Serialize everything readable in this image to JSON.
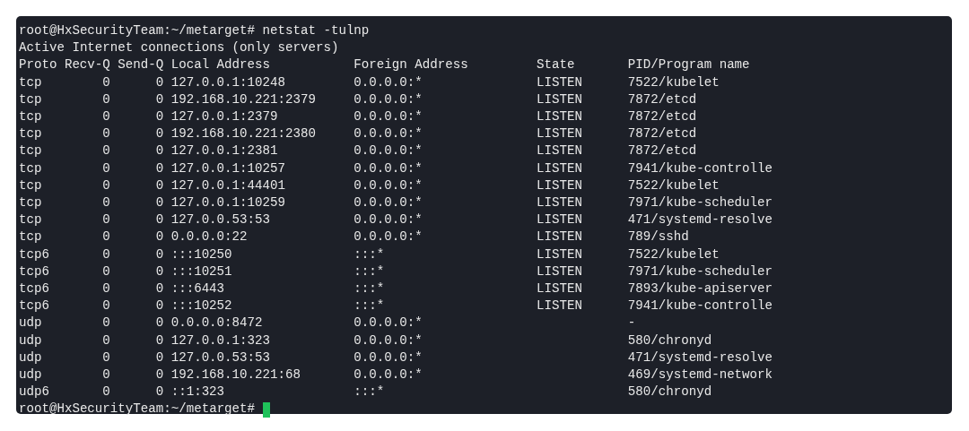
{
  "terminal": {
    "command_line": "root@HxSecurityTeam:~/metarget# netstat -tulnp",
    "output_title": "Active Internet connections (only servers)",
    "columns": [
      "Proto",
      "Recv-Q",
      "Send-Q",
      "Local Address",
      "Foreign Address",
      "State",
      "PID/Program name"
    ],
    "rows": [
      {
        "proto": "tcp",
        "recv_q": "0",
        "send_q": "0",
        "local_address": "127.0.0.1:10248",
        "foreign_address": "0.0.0.0:*",
        "state": "LISTEN",
        "program": "7522/kubelet"
      },
      {
        "proto": "tcp",
        "recv_q": "0",
        "send_q": "0",
        "local_address": "192.168.10.221:2379",
        "foreign_address": "0.0.0.0:*",
        "state": "LISTEN",
        "program": "7872/etcd"
      },
      {
        "proto": "tcp",
        "recv_q": "0",
        "send_q": "0",
        "local_address": "127.0.0.1:2379",
        "foreign_address": "0.0.0.0:*",
        "state": "LISTEN",
        "program": "7872/etcd"
      },
      {
        "proto": "tcp",
        "recv_q": "0",
        "send_q": "0",
        "local_address": "192.168.10.221:2380",
        "foreign_address": "0.0.0.0:*",
        "state": "LISTEN",
        "program": "7872/etcd"
      },
      {
        "proto": "tcp",
        "recv_q": "0",
        "send_q": "0",
        "local_address": "127.0.0.1:2381",
        "foreign_address": "0.0.0.0:*",
        "state": "LISTEN",
        "program": "7872/etcd"
      },
      {
        "proto": "tcp",
        "recv_q": "0",
        "send_q": "0",
        "local_address": "127.0.0.1:10257",
        "foreign_address": "0.0.0.0:*",
        "state": "LISTEN",
        "program": "7941/kube-controlle"
      },
      {
        "proto": "tcp",
        "recv_q": "0",
        "send_q": "0",
        "local_address": "127.0.0.1:44401",
        "foreign_address": "0.0.0.0:*",
        "state": "LISTEN",
        "program": "7522/kubelet"
      },
      {
        "proto": "tcp",
        "recv_q": "0",
        "send_q": "0",
        "local_address": "127.0.0.1:10259",
        "foreign_address": "0.0.0.0:*",
        "state": "LISTEN",
        "program": "7971/kube-scheduler"
      },
      {
        "proto": "tcp",
        "recv_q": "0",
        "send_q": "0",
        "local_address": "127.0.0.53:53",
        "foreign_address": "0.0.0.0:*",
        "state": "LISTEN",
        "program": "471/systemd-resolve"
      },
      {
        "proto": "tcp",
        "recv_q": "0",
        "send_q": "0",
        "local_address": "0.0.0.0:22",
        "foreign_address": "0.0.0.0:*",
        "state": "LISTEN",
        "program": "789/sshd"
      },
      {
        "proto": "tcp6",
        "recv_q": "0",
        "send_q": "0",
        "local_address": ":::10250",
        "foreign_address": ":::*",
        "state": "LISTEN",
        "program": "7522/kubelet"
      },
      {
        "proto": "tcp6",
        "recv_q": "0",
        "send_q": "0",
        "local_address": ":::10251",
        "foreign_address": ":::*",
        "state": "LISTEN",
        "program": "7971/kube-scheduler"
      },
      {
        "proto": "tcp6",
        "recv_q": "0",
        "send_q": "0",
        "local_address": ":::6443",
        "foreign_address": ":::*",
        "state": "LISTEN",
        "program": "7893/kube-apiserver"
      },
      {
        "proto": "tcp6",
        "recv_q": "0",
        "send_q": "0",
        "local_address": ":::10252",
        "foreign_address": ":::*",
        "state": "LISTEN",
        "program": "7941/kube-controlle"
      },
      {
        "proto": "udp",
        "recv_q": "0",
        "send_q": "0",
        "local_address": "0.0.0.0:8472",
        "foreign_address": "0.0.0.0:*",
        "program": "-"
      },
      {
        "proto": "udp",
        "recv_q": "0",
        "send_q": "0",
        "local_address": "127.0.0.1:323",
        "foreign_address": "0.0.0.0:*",
        "program": "580/chronyd"
      },
      {
        "proto": "udp",
        "recv_q": "0",
        "send_q": "0",
        "local_address": "127.0.0.53:53",
        "foreign_address": "0.0.0.0:*",
        "program": "471/systemd-resolve"
      },
      {
        "proto": "udp",
        "recv_q": "0",
        "send_q": "0",
        "local_address": "192.168.10.221:68",
        "foreign_address": "0.0.0.0:*",
        "program": "469/systemd-network"
      },
      {
        "proto": "udp6",
        "recv_q": "0",
        "send_q": "0",
        "local_address": "::1:323",
        "foreign_address": ":::*",
        "program": "580/chronyd"
      }
    ],
    "prompt": "root@HxSecurityTeam:~/metarget#"
  }
}
